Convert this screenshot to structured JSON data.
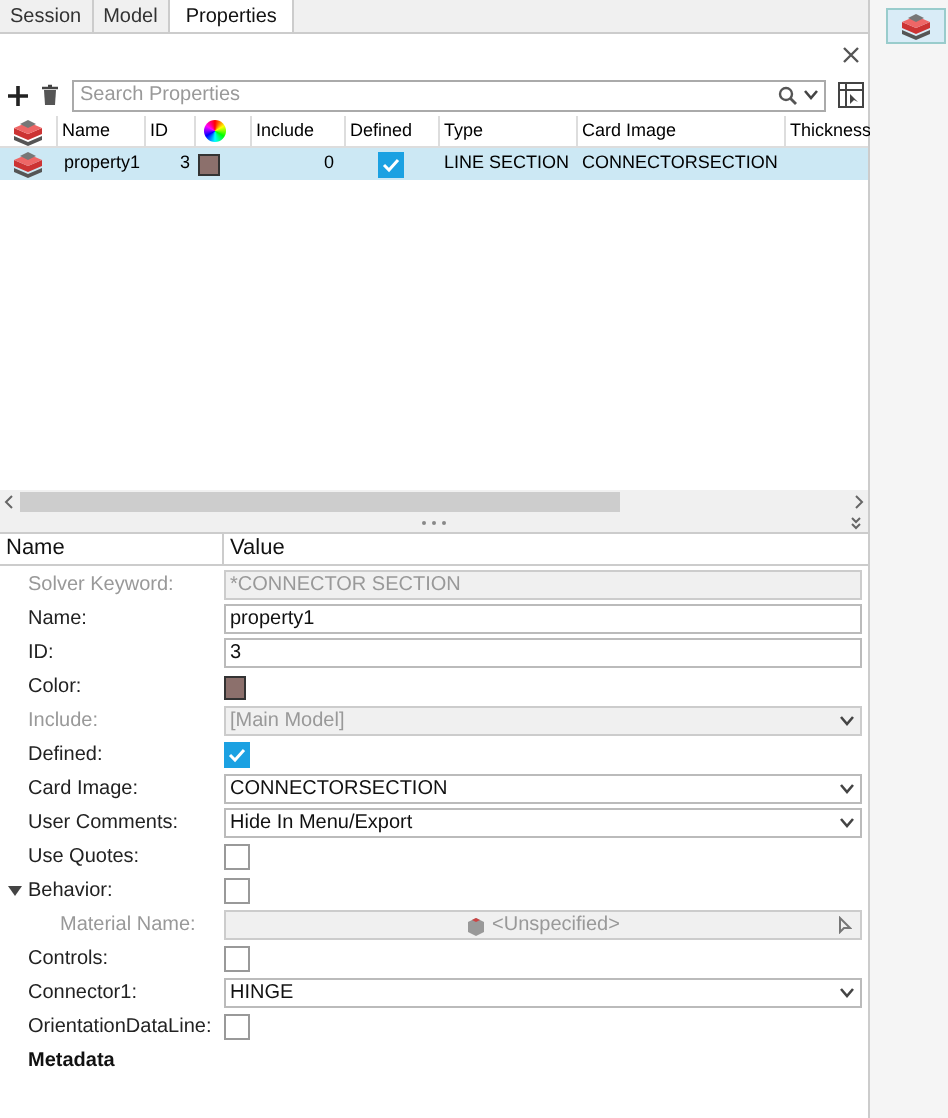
{
  "tabs": [
    {
      "label": "Session",
      "selected": false
    },
    {
      "label": "Model",
      "selected": false
    },
    {
      "label": "Properties",
      "selected": true
    }
  ],
  "search": {
    "placeholder": "Search Properties"
  },
  "table": {
    "columns": [
      "Name",
      "ID",
      "Include",
      "Defined",
      "Type",
      "Card Image",
      "Thickness"
    ],
    "rows": [
      {
        "name": "property1",
        "id": "3",
        "color": "#8c706c",
        "include": "0",
        "defined": true,
        "type": "LINE SECTION",
        "card_image": "CONNECTORSECTION",
        "selected": true
      }
    ]
  },
  "grid": {
    "columns": [
      "Name",
      "Value"
    ],
    "rows": [
      {
        "kind": "text",
        "label": "Solver Keyword:",
        "value": "*CONNECTOR SECTION",
        "disabled": true
      },
      {
        "kind": "text",
        "label": "Name:",
        "value": "property1",
        "disabled": false
      },
      {
        "kind": "text",
        "label": "ID:",
        "value": "3",
        "disabled": false
      },
      {
        "kind": "color",
        "label": "Color:",
        "color": "#8c706c"
      },
      {
        "kind": "select",
        "label": "Include:",
        "value": "[Main Model]",
        "disabled": true
      },
      {
        "kind": "checkbox",
        "label": "Defined:",
        "checked": true
      },
      {
        "kind": "select",
        "label": "Card Image:",
        "value": "CONNECTORSECTION",
        "disabled": false
      },
      {
        "kind": "select",
        "label": "User Comments:",
        "value": "Hide In Menu/Export",
        "disabled": false
      },
      {
        "kind": "checkbox",
        "label": "Use Quotes:",
        "checked": false
      },
      {
        "kind": "checkbox",
        "label": "Behavior:",
        "checked": false,
        "expanded": true,
        "children": [
          {
            "kind": "reference",
            "label": "Material Name:",
            "value": "<Unspecified>",
            "disabled": true
          }
        ]
      },
      {
        "kind": "checkbox",
        "label": "Controls:",
        "checked": false
      },
      {
        "kind": "select",
        "label": "Connector1:",
        "value": "HINGE",
        "disabled": false
      },
      {
        "kind": "checkbox",
        "label": "OrientationDataLine:",
        "checked": false
      },
      {
        "kind": "group",
        "label": "Metadata"
      }
    ]
  }
}
